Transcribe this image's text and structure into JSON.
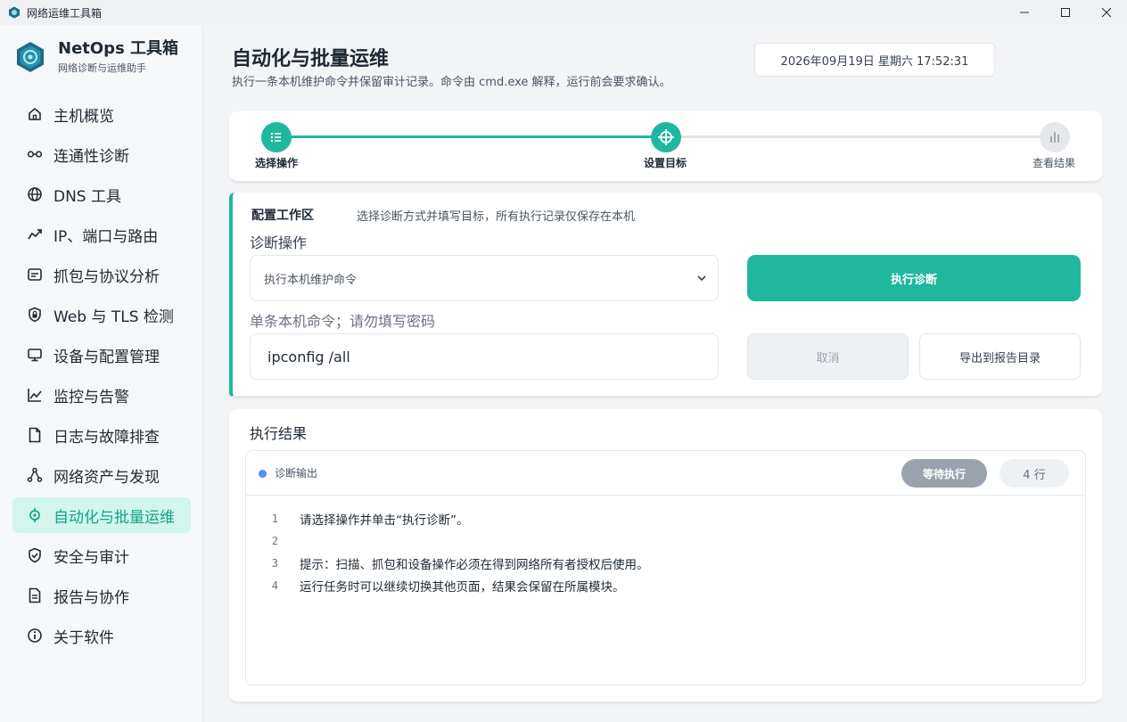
{
  "window": {
    "title": "网络运维工具箱"
  },
  "brand": {
    "name": "NetOps 工具箱",
    "subtitle": "网络诊断与运维助手"
  },
  "sidebar": {
    "items": [
      {
        "label": "主机概览",
        "icon": "home-icon"
      },
      {
        "label": "连通性诊断",
        "icon": "link-icon"
      },
      {
        "label": "DNS 工具",
        "icon": "globe-icon"
      },
      {
        "label": "IP、端口与路由",
        "icon": "trend-icon"
      },
      {
        "label": "抓包与协议分析",
        "icon": "packet-icon"
      },
      {
        "label": "Web 与 TLS 检测",
        "icon": "shield-lock-icon"
      },
      {
        "label": "设备与配置管理",
        "icon": "monitor-icon"
      },
      {
        "label": "监控与告警",
        "icon": "chart-icon"
      },
      {
        "label": "日志与故障排查",
        "icon": "file-icon"
      },
      {
        "label": "网络资产与发现",
        "icon": "nodes-icon"
      },
      {
        "label": "自动化与批量运维",
        "icon": "target-icon",
        "active": true
      },
      {
        "label": "安全与审计",
        "icon": "shield-check-icon"
      },
      {
        "label": "报告与协作",
        "icon": "report-icon"
      },
      {
        "label": "关于软件",
        "icon": "info-icon"
      }
    ]
  },
  "header": {
    "title": "自动化与批量运维",
    "subtitle": "执行一条本机维护命令并保留审计记录。命令由 cmd.exe 解释，运行前会要求确认。",
    "datetime": "2026年09月19日  星期六  17:52:31"
  },
  "stepper": {
    "steps": [
      {
        "label": "选择操作",
        "state": "done",
        "icon": "list-icon"
      },
      {
        "label": "设置目标",
        "state": "done",
        "icon": "crosshair-icon"
      },
      {
        "label": "查看结果",
        "state": "todo",
        "icon": "bars-icon"
      }
    ]
  },
  "config": {
    "title": "配置工作区",
    "hint": "选择诊断方式并填写目标，所有执行记录仅保存在本机",
    "operation_label": "诊断操作",
    "operation_value": "执行本机维护命令",
    "command_label": "单条本机命令；请勿填写密码",
    "command_value": "ipconfig /all",
    "run_label": "执行诊断",
    "cancel_label": "取消",
    "export_label": "导出到报告目录"
  },
  "result": {
    "title": "执行结果",
    "output_title": "诊断输出",
    "status_badge": "等待执行",
    "line_count": "4 行",
    "lines": [
      {
        "num": "1",
        "text": "请选择操作并单击“执行诊断”。"
      },
      {
        "num": "2",
        "text": ""
      },
      {
        "num": "3",
        "text": "提示：扫描、抓包和设备操作必须在得到网络所有者授权后使用。"
      },
      {
        "num": "4",
        "text": "运行任务时可以继续切换其他页面，结果会保留在所属模块。"
      }
    ]
  },
  "colors": {
    "accent": "#1fb89e",
    "active_bg": "#d2f5ec",
    "status_gray": "#9aa3ad",
    "dot_blue": "#4f8ff7"
  }
}
